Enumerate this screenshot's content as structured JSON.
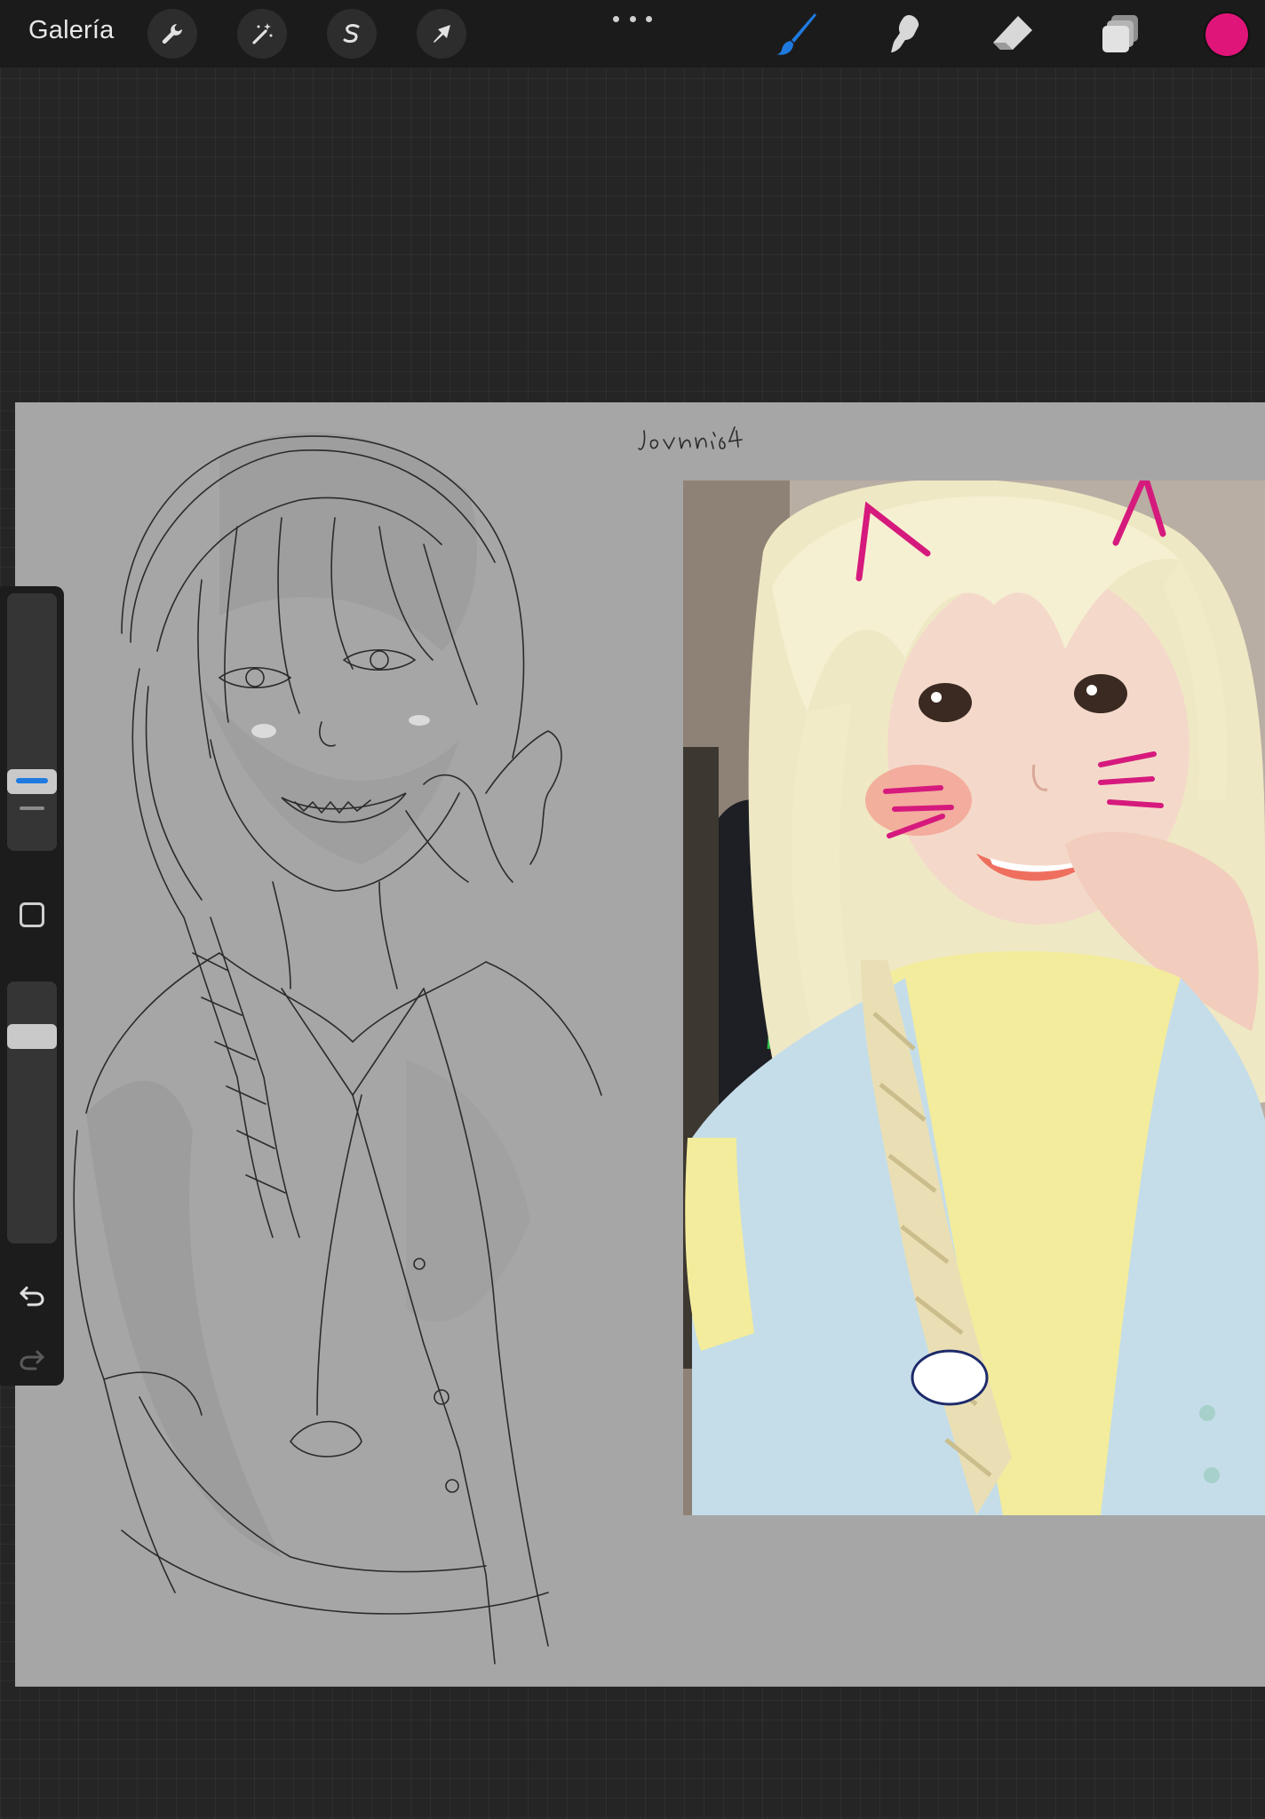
{
  "toolbar": {
    "gallery_label": "Galería",
    "actions_icon": "wrench-icon",
    "adjustments_icon": "magic-wand-icon",
    "selection_icon": "selection-s-icon",
    "transform_icon": "arrow-cursor-icon",
    "more_icon": "ellipsis-icon",
    "brush_icon": "brush-icon",
    "smudge_icon": "smudge-icon",
    "eraser_icon": "eraser-icon",
    "layers_icon": "layers-icon",
    "active_tool": "brush",
    "active_color": "#e0157a"
  },
  "sidebar": {
    "brush_size_level": 0.85,
    "opacity_level": 0.15,
    "modify_icon": "square-icon",
    "undo_icon": "undo-icon",
    "redo_icon": "redo-icon"
  },
  "canvas": {
    "background": "#a6a6a6",
    "signature_text": "Jevnn64",
    "reference_photo": "cosplay-reference-photo",
    "sketch": "pencil-sketch"
  },
  "colors": {
    "accent": "#1f7ae0",
    "active_color": "#e0157a",
    "toolbar_bg": "#1b1b1b"
  }
}
